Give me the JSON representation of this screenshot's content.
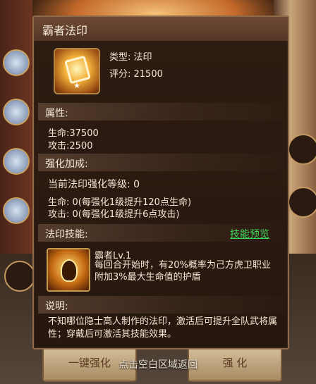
{
  "popup": {
    "title": "霸者法印",
    "item": {
      "type_line": "类型: 法印",
      "score_line": "评分: 21500"
    },
    "attributes": {
      "header": "属性:",
      "hp": "生命:37500",
      "atk": "攻击:2500"
    },
    "enhance": {
      "header": "强化加成:",
      "level": "当前法印强化等级: 0",
      "hp": "生命: 0(每强化1级提升120点生命)",
      "atk": "攻击: 0(每强化1级提升6点攻击)"
    },
    "skill": {
      "header": "法印技能:",
      "preview_link": "技能预览",
      "name": "霸者Lv.1",
      "description": "每回合开始时，有20%概率为己方虎卫职业附加3%最大生命值的护盾"
    },
    "note": {
      "header": "说明:",
      "text": "不知哪位隐士高人制作的法印，激活后可提升全队武将属性；穿戴后可激活其技能效果。"
    }
  },
  "background": {
    "left_button": "一键强化",
    "right_button": "强 化"
  },
  "hint": "点击空白区域返回",
  "colors": {
    "link": "#3fd65a",
    "panel_border": "#8e6a48"
  }
}
